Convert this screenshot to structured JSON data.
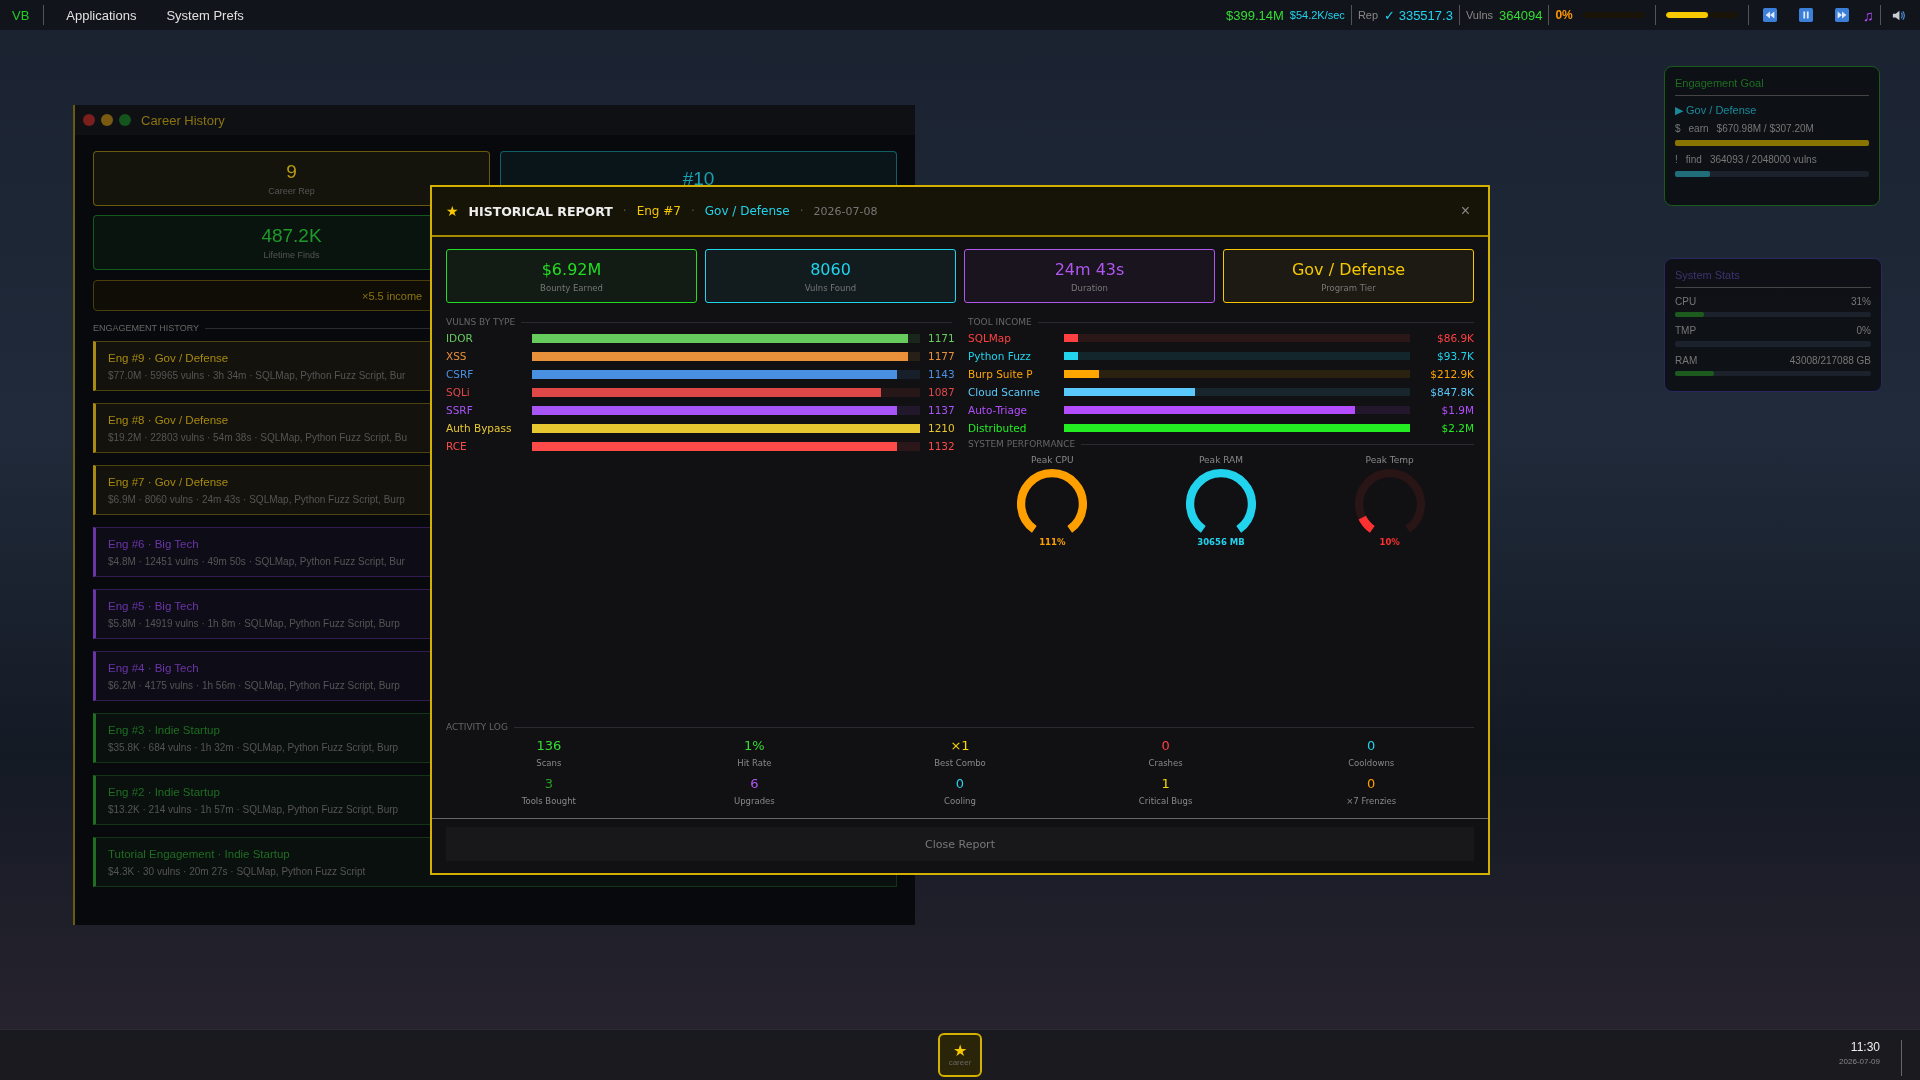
{
  "top_bar": {
    "logo": "VB",
    "menus": [
      "Applications",
      "System Prefs"
    ],
    "money": "$399.14M",
    "rate": "$54.2K/sec",
    "rep_label": "Rep",
    "rep_value": "✓ 335517.3",
    "vulns_label": "Vulns",
    "vulns_value": "364094",
    "heat": "0%",
    "meters": [
      {
        "level": 0
      },
      {
        "level": 0.58
      }
    ],
    "music_note": "♫"
  },
  "career_window": {
    "title": "Career History",
    "stats": [
      {
        "value": "9",
        "label": "Career Rep",
        "color": "#b89a10"
      },
      {
        "value": "#10",
        "color": "#1aa0b0"
      },
      {
        "value": "487.2K",
        "label": "Lifetime Finds",
        "color": "#1f9a2a"
      }
    ],
    "income_note": "×5.5 income",
    "section_label": "ENGAGEMENT HISTORY",
    "engagements": [
      {
        "title": "Eng #9 · Gov / Defense",
        "meta": "$77.0M · 59965 vulns · 3h 34m · SQLMap, Python Fuzz Script, Bur",
        "color": "#a88a10"
      },
      {
        "title": "Eng #8 · Gov / Defense",
        "meta": "$19.2M · 22803 vulns · 54m 38s · SQLMap, Python Fuzz Script, Bu",
        "color": "#a88a10"
      },
      {
        "title": "Eng #7 · Gov / Defense",
        "meta": "$6.9M · 8060 vulns · 24m 43s · SQLMap, Python Fuzz Script, Burp",
        "color": "#a88a10"
      },
      {
        "title": "Eng #6 · Big Tech",
        "meta": "$4.8M · 12451 vulns · 49m 50s · SQLMap, Python Fuzz Script, Bur",
        "color": "#6a35a8"
      },
      {
        "title": "Eng #5 · Big Tech",
        "meta": "$5.8M · 14919 vulns · 1h 8m · SQLMap, Python Fuzz Script, Burp",
        "color": "#6a35a8"
      },
      {
        "title": "Eng #4 · Big Tech",
        "meta": "$6.2M · 4175 vulns · 1h 56m · SQLMap, Python Fuzz Script, Burp",
        "color": "#6a35a8"
      },
      {
        "title": "Eng #3 · Indie Startup",
        "meta": "$35.8K · 684 vulns · 1h 32m · SQLMap, Python Fuzz Script, Burp",
        "color": "#1f6e22"
      },
      {
        "title": "Eng #2 · Indie Startup",
        "meta": "$13.2K · 214 vulns · 1h 57m · SQLMap, Python Fuzz Script, Burp",
        "color": "#1f6e22"
      },
      {
        "title": "Tutorial Engagement · Indie Startup",
        "meta": "$4.3K · 30 vulns · 20m 27s · SQLMap, Python Fuzz Script",
        "color": "#1f6e22"
      }
    ]
  },
  "report": {
    "star": "★",
    "title": "HISTORICAL REPORT",
    "separator": "·",
    "engagement": "Eng #7",
    "tier": "Gov / Defense",
    "date": "2026-07-08",
    "close": "×",
    "cards": [
      {
        "value": "$6.92M",
        "label": "Bounty Earned",
        "color": "#22dd22"
      },
      {
        "value": "8060",
        "label": "Vulns Found",
        "color": "#22d3ee"
      },
      {
        "value": "24m 43s",
        "label": "Duration",
        "color": "#b057f0"
      },
      {
        "value": "Gov / Defense",
        "label": "Program Tier",
        "color": "#f5c800"
      }
    ],
    "vulns_label": "VULNS BY TYPE",
    "vulns": [
      {
        "name": "IDOR",
        "level": 0.97,
        "count": "1171",
        "color": "#66cc5e"
      },
      {
        "name": "XSS",
        "level": 0.97,
        "count": "1177",
        "color": "#e8913a"
      },
      {
        "name": "CSRF",
        "level": 0.94,
        "count": "1143",
        "color": "#4a90e2"
      },
      {
        "name": "SQLi",
        "level": 0.9,
        "count": "1087",
        "color": "#e04848"
      },
      {
        "name": "SSRF",
        "level": 0.94,
        "count": "1137",
        "color": "#a855f7"
      },
      {
        "name": "Auth Bypass",
        "level": 1,
        "count": "1210",
        "color": "#e8c830"
      },
      {
        "name": "RCE",
        "level": 0.94,
        "count": "1132",
        "color": "#ff4a4a"
      }
    ],
    "tools_label": "TOOL INCOME",
    "tools": [
      {
        "name": "SQLMap",
        "level": 0.04,
        "value": "$86.9K",
        "color": "#ff4040"
      },
      {
        "name": "Python Fuzz",
        "level": 0.04,
        "value": "$93.7K",
        "color": "#22d3ee"
      },
      {
        "name": "Burp Suite P",
        "level": 0.1,
        "value": "$212.9K",
        "color": "#ffa500"
      },
      {
        "name": "Cloud Scanne",
        "level": 0.38,
        "value": "$847.8K",
        "color": "#5ac8fa"
      },
      {
        "name": "Auto-Triage",
        "level": 0.84,
        "value": "$1.9M",
        "color": "#b44dff"
      },
      {
        "name": "Distributed",
        "level": 1,
        "value": "$2.2M",
        "color": "#22ee22"
      }
    ],
    "performance_label": "SYSTEM PERFORMANCE",
    "gauges": [
      {
        "label": "Peak CPU",
        "level": 1,
        "reading": "111%",
        "color": "#ffa000"
      },
      {
        "label": "Peak RAM",
        "level": 1,
        "reading": "30656 MB",
        "color": "#22d3ee"
      },
      {
        "label": "Peak Temp",
        "level": 0.1,
        "reading": "10%",
        "color": "#ff3030"
      }
    ],
    "activity_label": "ACTIVITY LOG",
    "activity": [
      {
        "value": "136",
        "label": "Scans",
        "color": "#33dd33"
      },
      {
        "value": "1%",
        "label": "Hit Rate",
        "color": "#33dd33"
      },
      {
        "value": "×1",
        "label": "Best Combo",
        "color": "#f5d800"
      },
      {
        "value": "0",
        "label": "Crashes",
        "color": "#ff4040"
      },
      {
        "value": "0",
        "label": "Cooldowns",
        "color": "#22d3ee"
      },
      {
        "value": "3",
        "label": "Tools Bought",
        "color": "#22a022"
      },
      {
        "value": "6",
        "label": "Upgrades",
        "color": "#b057f0"
      },
      {
        "value": "0",
        "label": "Cooling",
        "color": "#22d3ee"
      },
      {
        "value": "1",
        "label": "Critical Bugs",
        "color": "#f5d800"
      },
      {
        "value": "0",
        "label": "×7 Frenzies",
        "color": "#ffa000"
      }
    ],
    "button": "Close Report"
  },
  "goal_widget": {
    "title": "Engagement Goal",
    "marker": "▶",
    "tier": "Gov / Defense",
    "goals": [
      {
        "symbol": "$",
        "label": "earn",
        "value": "$670.98M / $307.20M",
        "level": 1,
        "kind": "money"
      },
      {
        "symbol": "!",
        "label": "find",
        "value": "364093 / 2048000 vulns",
        "level": 0.18,
        "kind": "vulns"
      }
    ]
  },
  "stats_widget": {
    "title": "System Stats",
    "stats": [
      {
        "label": "CPU",
        "value": "31%",
        "level": 0.15
      },
      {
        "label": "TMP",
        "value": "0%",
        "level": 0
      },
      {
        "label": "RAM",
        "value": "43008/217088 GB",
        "level": 0.2
      }
    ]
  },
  "taskbar": {
    "apps": [
      {
        "icon": "★",
        "label": "career",
        "selected": true
      }
    ],
    "time": "11:30",
    "date": "2026-07-09"
  }
}
